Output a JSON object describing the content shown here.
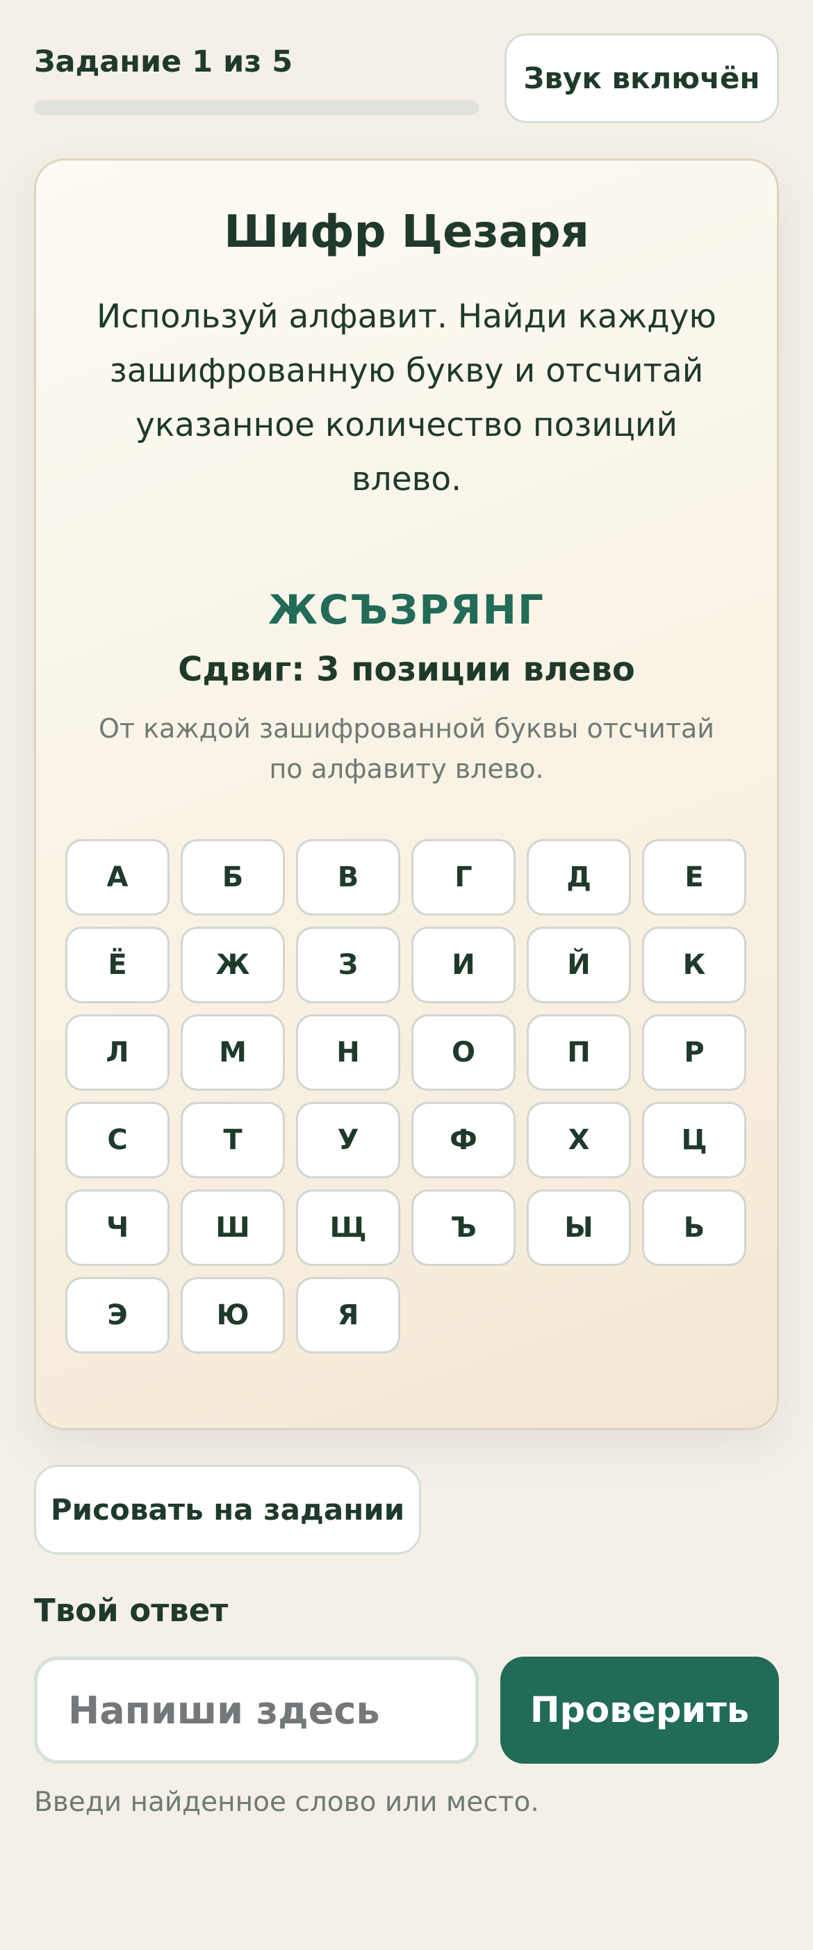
{
  "header": {
    "task_label": "Задание 1 из 5",
    "progress": 0,
    "sound_button": "Звук включён"
  },
  "card": {
    "title": "Шифр Цезаря",
    "instructions": "Используй алфавит. Найди каждую зашифрованную букву и отсчитай указанное количество позиций влево.",
    "cipher_word": "ЖСЪЗРЯНГ",
    "shift_label": "Сдвиг: 3 позиции влево",
    "shift_hint": "От каждой зашифрованной буквы отсчитай по алфавиту влево.",
    "alphabet": [
      "А",
      "Б",
      "В",
      "Г",
      "Д",
      "Е",
      "Ё",
      "Ж",
      "З",
      "И",
      "Й",
      "К",
      "Л",
      "М",
      "Н",
      "О",
      "П",
      "Р",
      "С",
      "Т",
      "У",
      "Ф",
      "Х",
      "Ц",
      "Ч",
      "Ш",
      "Щ",
      "Ъ",
      "Ы",
      "Ь",
      "Э",
      "Ю",
      "Я"
    ]
  },
  "draw_button": "Рисовать на задании",
  "answer": {
    "label": "Твой ответ",
    "placeholder": "Напиши здесь",
    "value": "",
    "check_button": "Проверить",
    "hint": "Введи найденное слово или место."
  },
  "colors": {
    "accent": "#216b58",
    "background": "#f4f0e8",
    "text": "#1f3a2b"
  }
}
